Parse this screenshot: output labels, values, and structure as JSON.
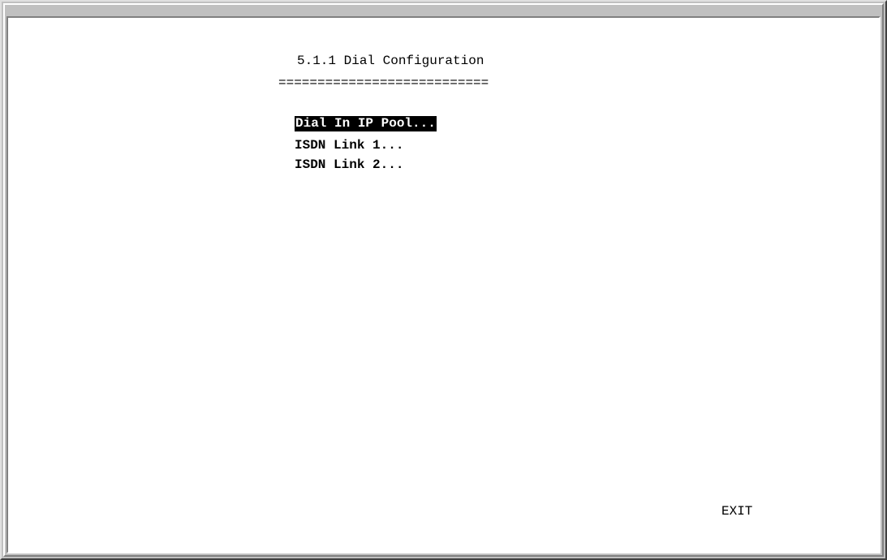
{
  "screen": {
    "title": "5.1.1 Dial Configuration",
    "title_underline": "==========================="
  },
  "menu": {
    "items": [
      {
        "label": "Dial In IP Pool...",
        "selected": true
      },
      {
        "label": "ISDN Link 1...",
        "selected": false
      },
      {
        "label": "ISDN Link 2...",
        "selected": false
      }
    ]
  },
  "footer": {
    "exit_label": "EXIT"
  },
  "colors": {
    "background": "#ffffff",
    "text": "#000000",
    "highlight_bg": "#000000",
    "highlight_fg": "#ffffff",
    "frame": "#c0c0c0"
  }
}
